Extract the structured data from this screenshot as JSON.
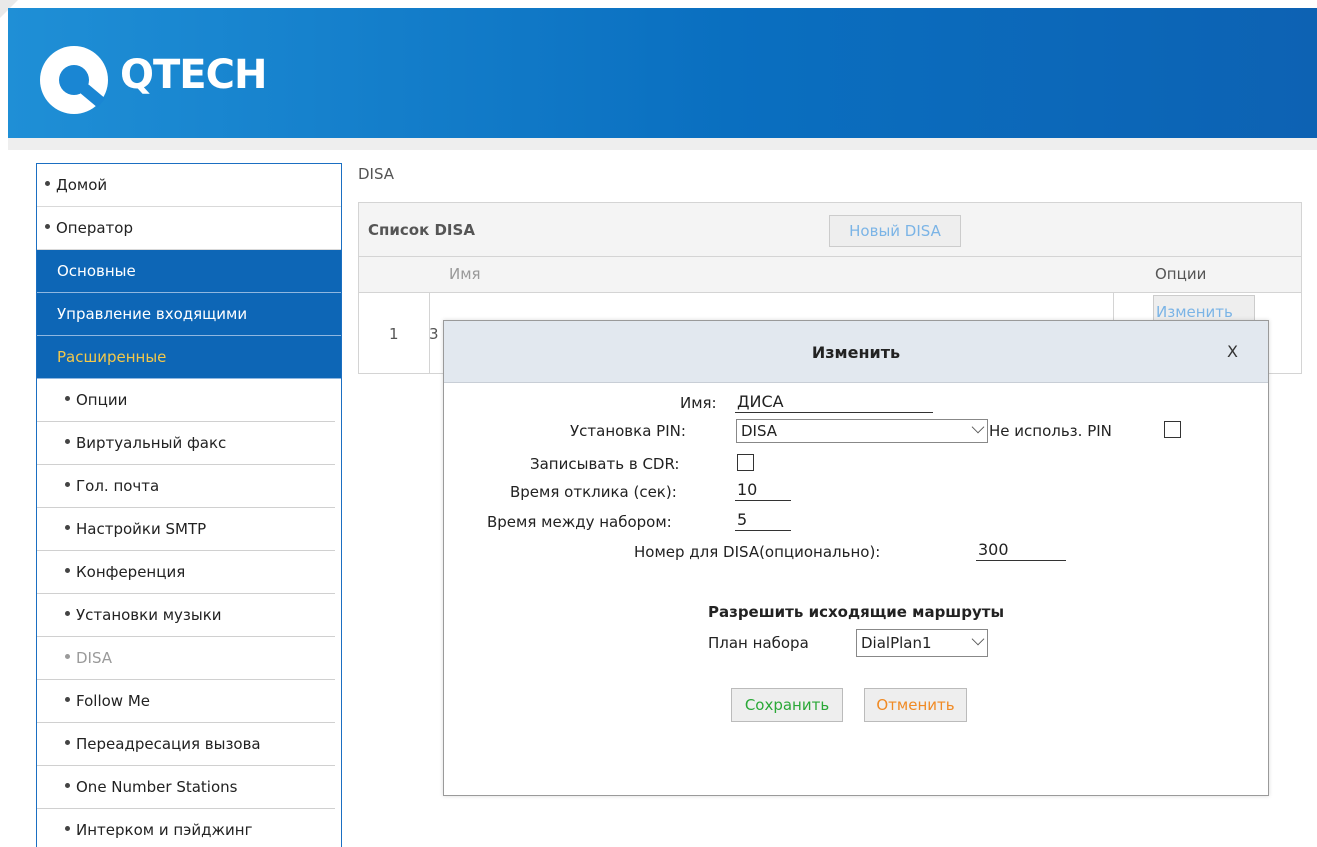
{
  "header": {
    "logo_text": "QTECH",
    "brand_color": "#0d66b6"
  },
  "sidebar": {
    "items": [
      {
        "label": "Домой"
      },
      {
        "label": "Оператор"
      }
    ],
    "sections": [
      {
        "label": "Основные"
      },
      {
        "label": "Управление входящими"
      },
      {
        "label": "Расширенные"
      }
    ],
    "sub_items": [
      {
        "label": "Опции"
      },
      {
        "label": "Виртуальный факс"
      },
      {
        "label": "Гол. почта"
      },
      {
        "label": "Настройки SMTP"
      },
      {
        "label": "Конференция"
      },
      {
        "label": "Установки музыки"
      },
      {
        "label": "DISA"
      },
      {
        "label": "Follow Me"
      },
      {
        "label": "Переадресация вызова"
      },
      {
        "label": "One Number Stations"
      },
      {
        "label": "Интерком и пэйджинг"
      }
    ]
  },
  "main": {
    "breadcrumb": "DISA",
    "list_title": "Список DISA",
    "new_button": "Новый DISA",
    "columns": {
      "name": "Имя",
      "options": "Опции"
    },
    "rows": [
      {
        "num": "1",
        "name": "3",
        "action": "Изменить"
      }
    ]
  },
  "modal": {
    "title": "Изменить",
    "close": "X",
    "name_label": "Имя:",
    "name_value": "ДИСА",
    "pin_label": "Установка PIN:",
    "pin_value": "DISA",
    "no_pin_label": "Не использ. PIN",
    "cdr_label": "Записывать в CDR:",
    "response_label": "Время отклика (сек):",
    "response_value": "10",
    "interdigit_label": "Время между набором:",
    "interdigit_value": "5",
    "number_label": "Номер для DISA(опционально):",
    "number_value": "300",
    "routes_title": "Разрешить исходящие маршруты",
    "dialplan_label": "План набора",
    "dialplan_value": "DialPlan1",
    "save": "Сохранить",
    "cancel": "Отменить",
    "save_color": "#2aa837",
    "cancel_color": "#f08a24"
  }
}
